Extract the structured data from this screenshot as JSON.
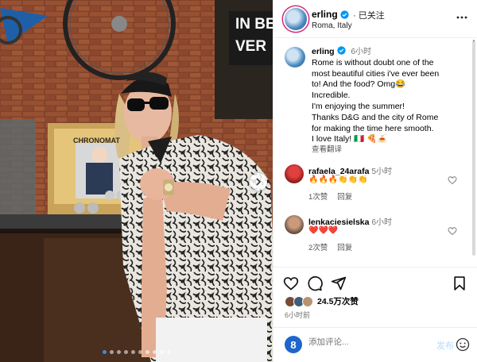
{
  "post": {
    "username": "erling",
    "follow_label": "· 已关注",
    "location": "Roma, Italy",
    "caption_username": "erling",
    "caption_time": "6小时",
    "caption_lines": [
      "Rome is without doubt one of the",
      "most beautiful cities i've ever been",
      "to! And the food? Omg😂",
      "Incredible.",
      "I'm enjoying the summer!",
      "Thanks D&G and the city of Rome",
      "for making the time here smooth.",
      "I love Italy! 🇮🇹 🍕🍝"
    ],
    "translate_label": "查看翻译",
    "comments": [
      {
        "username": "rafaela_24arafa",
        "time": "5小时",
        "emoji": "🔥🔥🔥👏👏👏",
        "likes": "1次赞",
        "reply": "回复"
      },
      {
        "username": "lenkaciesielska",
        "time": "6小时",
        "emoji": "❤️❤️❤️",
        "likes": "2次赞",
        "reply": "回复"
      }
    ],
    "likes_text": "24.5万次赞",
    "posted_ago": "6小时前",
    "comment_placeholder": "添加评论...",
    "post_button": "发布",
    "composer_avatar_letter": "8"
  },
  "media": {
    "slide_count": 10,
    "active_slide": 1,
    "shop_sign": [
      "IN BE",
      "VER"
    ],
    "display_label": "CHRONOMAT"
  },
  "colors": {
    "accent_blue": "#0095f6",
    "heart_red": "#ed4956",
    "story_ring": "#d62976"
  },
  "icons": {
    "verified": "verified-badge-icon",
    "more": "more-options-icon",
    "like": "heart-icon",
    "comment": "comment-icon",
    "share": "share-icon",
    "save": "bookmark-icon",
    "emoji": "emoji-icon",
    "next": "chevron-right-icon"
  }
}
